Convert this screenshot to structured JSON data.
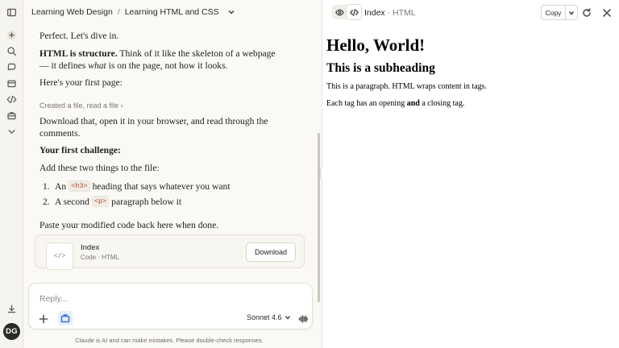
{
  "breadcrumb": {
    "project": "Learning Web Design",
    "separator": "/",
    "chat": "Learning HTML and CSS"
  },
  "rail": {
    "icons": [
      "sidebar-toggle-icon",
      "new-chat-icon",
      "search-icon",
      "chats-icon",
      "projects-icon",
      "code-icon",
      "artifacts-icon",
      "more-chevron-icon",
      "download-app-icon"
    ],
    "avatar_initials": "DG"
  },
  "messages": {
    "p1": "Perfect. Let's dive in.",
    "p2_bold": "HTML is structure.",
    "p2_a": " Think of it like the skeleton of a webpage — it defines ",
    "p2_em": "what",
    "p2_b": " is on the page, not how it looks.",
    "p3": "Here's your first page:",
    "tool_line": "Created a file, read a file",
    "p4": "Download that, open it in your browser, and read through the comments.",
    "p5_bold": "Your first challenge:",
    "p6": "Add these two things to the file:",
    "list": [
      {
        "num": "1.",
        "pre": "An ",
        "code": "<h3>",
        "post": " heading that says whatever you want"
      },
      {
        "num": "2.",
        "pre": "A second ",
        "code": "<p>",
        "post": " paragraph below it"
      }
    ],
    "p7": "Paste your modified code back here when done."
  },
  "artifact": {
    "thumb": "</>",
    "title": "Index",
    "subtitle": "Code · HTML",
    "download_label": "Download"
  },
  "composer": {
    "placeholder": "Reply...",
    "model": "Sonnet 4.6"
  },
  "disclaimer": "Claude is AI and can make mistakes. Please double-check responses.",
  "preview": {
    "title": "Index",
    "title_sep": " · ",
    "title_type": "HTML",
    "copy_label": "Copy",
    "doc": {
      "h1": "Hello, World!",
      "h2": "This is a subheading",
      "p1": "This is a paragraph. HTML wraps content in tags.",
      "p2_a": "Each tag has an opening ",
      "p2_bold": "and",
      "p2_b": " a closing tag."
    }
  },
  "colors": {
    "background": "#faf9f5",
    "inline_code": "#b5402d",
    "accent_blue": "#3a6fd8"
  }
}
